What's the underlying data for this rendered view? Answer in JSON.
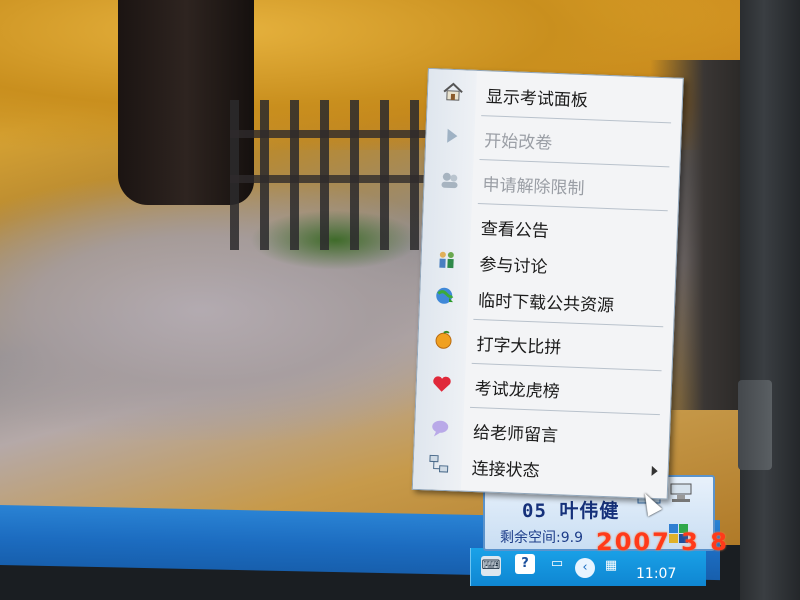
{
  "context_menu": {
    "items": [
      {
        "label": "显示考试面板",
        "icon": "home-icon",
        "enabled": true
      },
      {
        "label": "开始改卷",
        "icon": "play-icon",
        "enabled": false
      },
      {
        "label": "申请解除限制",
        "icon": "users-icon",
        "enabled": false
      },
      {
        "label": "查看公告",
        "icon": "",
        "enabled": true
      },
      {
        "label": "参与讨论",
        "icon": "people-icon",
        "enabled": true
      },
      {
        "label": "临时下载公共资源",
        "icon": "globe-download-icon",
        "enabled": true
      },
      {
        "label": "打字大比拼",
        "icon": "orange-icon",
        "enabled": true
      },
      {
        "label": "考试龙虎榜",
        "icon": "heart-icon",
        "enabled": true
      },
      {
        "label": "给老师留言",
        "icon": "message-icon",
        "enabled": true
      },
      {
        "label": "连接状态",
        "icon": "network-icon",
        "enabled": true,
        "has_submenu": true
      }
    ]
  },
  "exam_panel": {
    "student": "05 叶伟健",
    "space_label": "剩余空间:9.9"
  },
  "taskbar": {
    "clock": "11:07"
  },
  "photo_date": "2007  3  8"
}
